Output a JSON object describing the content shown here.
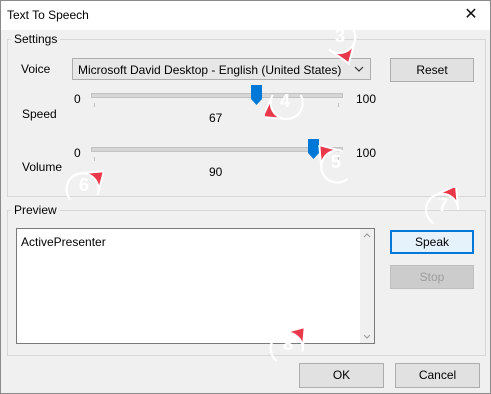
{
  "window": {
    "title": "Text To Speech",
    "close_glyph": "✕"
  },
  "settings": {
    "group_label": "Settings",
    "voice_label": "Voice",
    "voice_value": "Microsoft David Desktop - English (United States)",
    "reset_label": "Reset",
    "speed": {
      "label": "Speed",
      "min_label": "0",
      "max_label": "100",
      "value": "67",
      "level": 67
    },
    "volume": {
      "label": "Volume",
      "min_label": "0",
      "max_label": "100",
      "value": "90",
      "level": 90
    }
  },
  "preview": {
    "group_label": "Preview",
    "text": "ActivePresenter",
    "speak_label": "Speak",
    "stop_label": "Stop"
  },
  "footer": {
    "ok_label": "OK",
    "cancel_label": "Cancel"
  },
  "callouts": [
    "3",
    "4",
    "5",
    "6",
    "7",
    "8"
  ],
  "colors": {
    "accent": "#0078d7",
    "callout": "#e8384a"
  }
}
